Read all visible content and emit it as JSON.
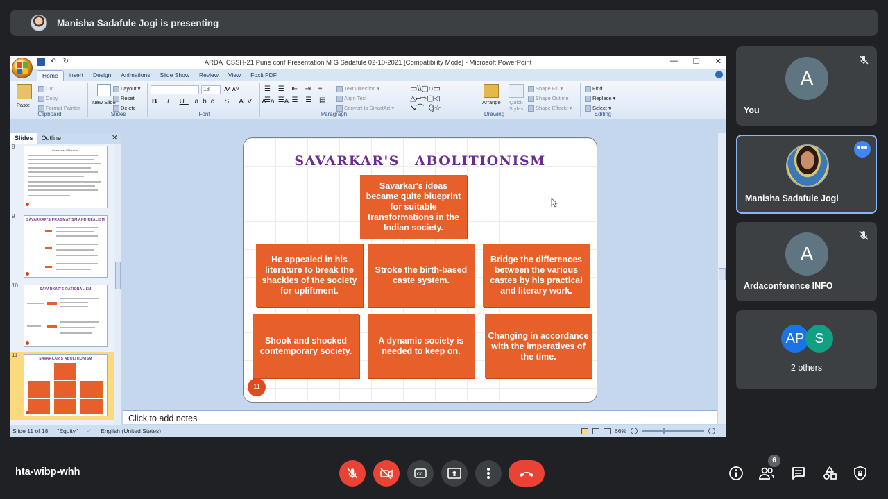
{
  "banner": {
    "presenter_text": "Manisha Sadafule Jogi is presenting"
  },
  "powerpoint": {
    "window_title": "ARDA ICSSH-21 Pune  conf Presentation M G Sadafule 02-10-2021 [Compatibility Mode] - Microsoft PowerPoint",
    "tabs": [
      "Home",
      "Insert",
      "Design",
      "Animations",
      "Slide Show",
      "Review",
      "View",
      "Foxit PDF"
    ],
    "ribbon": {
      "clipboard": {
        "label": "Clipboard",
        "paste": "Paste",
        "cut": "Cut",
        "copy": "Copy",
        "format_painter": "Format Painter"
      },
      "slides": {
        "label": "Slides",
        "new_slide": "New Slide",
        "layout": "Layout",
        "reset": "Reset",
        "delete": "Delete"
      },
      "font": {
        "label": "Font",
        "size": "18"
      },
      "paragraph": {
        "label": "Paragraph",
        "text_direction": "Text Direction",
        "align_text": "Align Text",
        "convert_smartart": "Convert to SmartArt"
      },
      "drawing": {
        "label": "Drawing",
        "arrange": "Arrange",
        "quick_styles": "Quick Styles",
        "shape_fill": "Shape Fill",
        "shape_outline": "Shape Outline",
        "shape_effects": "Shape Effects"
      },
      "editing": {
        "label": "Editing",
        "find": "Find",
        "replace": "Replace",
        "select": "Select"
      }
    },
    "pane_tabs": {
      "slides": "Slides",
      "outline": "Outline"
    },
    "thumb_numbers": [
      "8",
      "9",
      "10",
      "11"
    ],
    "thumb_titles": {
      "t8": "Sources / Studies",
      "t9": "SAVARKAR'S PRAGMATISM AND REALISM",
      "t10": "SAVARKAR'S RATIONALISM",
      "t11": "SAVARKAR'S ABOLITIONISM"
    },
    "notes_placeholder": "Click to add notes",
    "status": {
      "slide": "Slide 11 of 18",
      "theme": "\"Equity\"",
      "language": "English (United States)",
      "zoom": "66%"
    }
  },
  "slide": {
    "title": "SAVARKAR'S ABOLITIONISM",
    "number": "11",
    "boxes": {
      "top": "Savarkar's ideas became quite blueprint for suitable transformations in the Indian society.",
      "left": "He appealed in his literature to break the shackles of the society for upliftment.",
      "center": "Stroke the birth-based caste system.",
      "right": "Bridge the differences between the various castes by his practical and literary work.",
      "bottom_left": "Shook and shocked contemporary society.",
      "bottom_center": "A dynamic society is needed to keep on.",
      "bottom_right": "Changing in accordance with the imperatives of the time."
    }
  },
  "participants": [
    {
      "name": "You",
      "initial": "A",
      "muted": true
    },
    {
      "name": "Manisha Sadafule Jogi",
      "muted": false,
      "has_more_button": true
    },
    {
      "name": "Ardaconference INFO",
      "initial": "A",
      "muted": true
    },
    {
      "name": "2 others",
      "avatars": [
        "AP",
        "S"
      ]
    }
  ],
  "avatar_colors": {
    "gray": "#5f7682",
    "ap": "#1a73e8",
    "s": "#12a085"
  },
  "meeting": {
    "code": "hta-wibp-whh",
    "people_count": "6"
  },
  "colors": {
    "accent_orange": "#e7602a",
    "title_purple": "#6b2c8f",
    "danger_red": "#ea4335",
    "meet_bg": "#202124"
  }
}
